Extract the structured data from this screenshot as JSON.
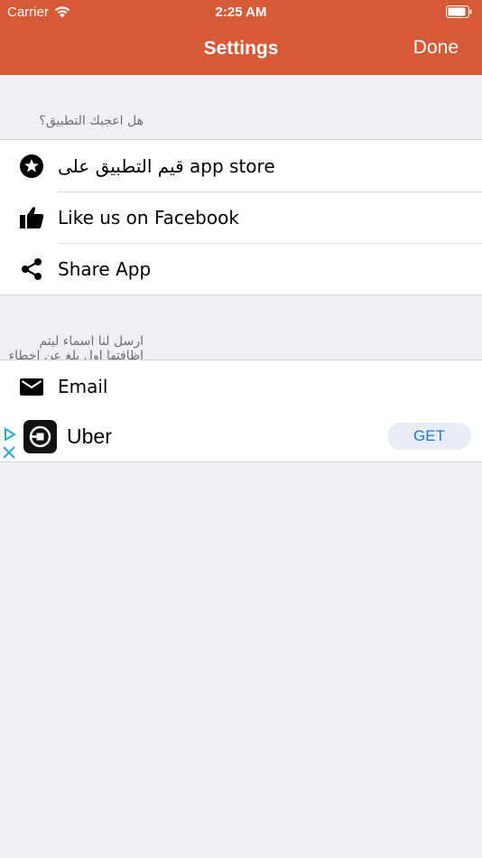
{
  "theme": {
    "accent": "#d75a37"
  },
  "status_bar": {
    "carrier": "Carrier",
    "time": "2:25 AM"
  },
  "nav": {
    "title": "Settings",
    "done": "Done"
  },
  "sections": [
    {
      "header": "هل اعجبك التطبيق؟",
      "rows": [
        {
          "icon": "star-circle-icon",
          "label": "قيم التطبيق على app store"
        },
        {
          "icon": "thumbs-up-icon",
          "label": "Like us on Facebook"
        },
        {
          "icon": "share-icon",
          "label": "Share App"
        }
      ]
    },
    {
      "header": "ارسل لنا اسماء ليتم اظافتها اول بلغ عن اخطاء",
      "rows": [
        {
          "icon": "envelope-icon",
          "label": "Email"
        }
      ]
    }
  ],
  "ad": {
    "title": "Uber",
    "cta": "GET",
    "cta_color": "#1a78d6"
  }
}
